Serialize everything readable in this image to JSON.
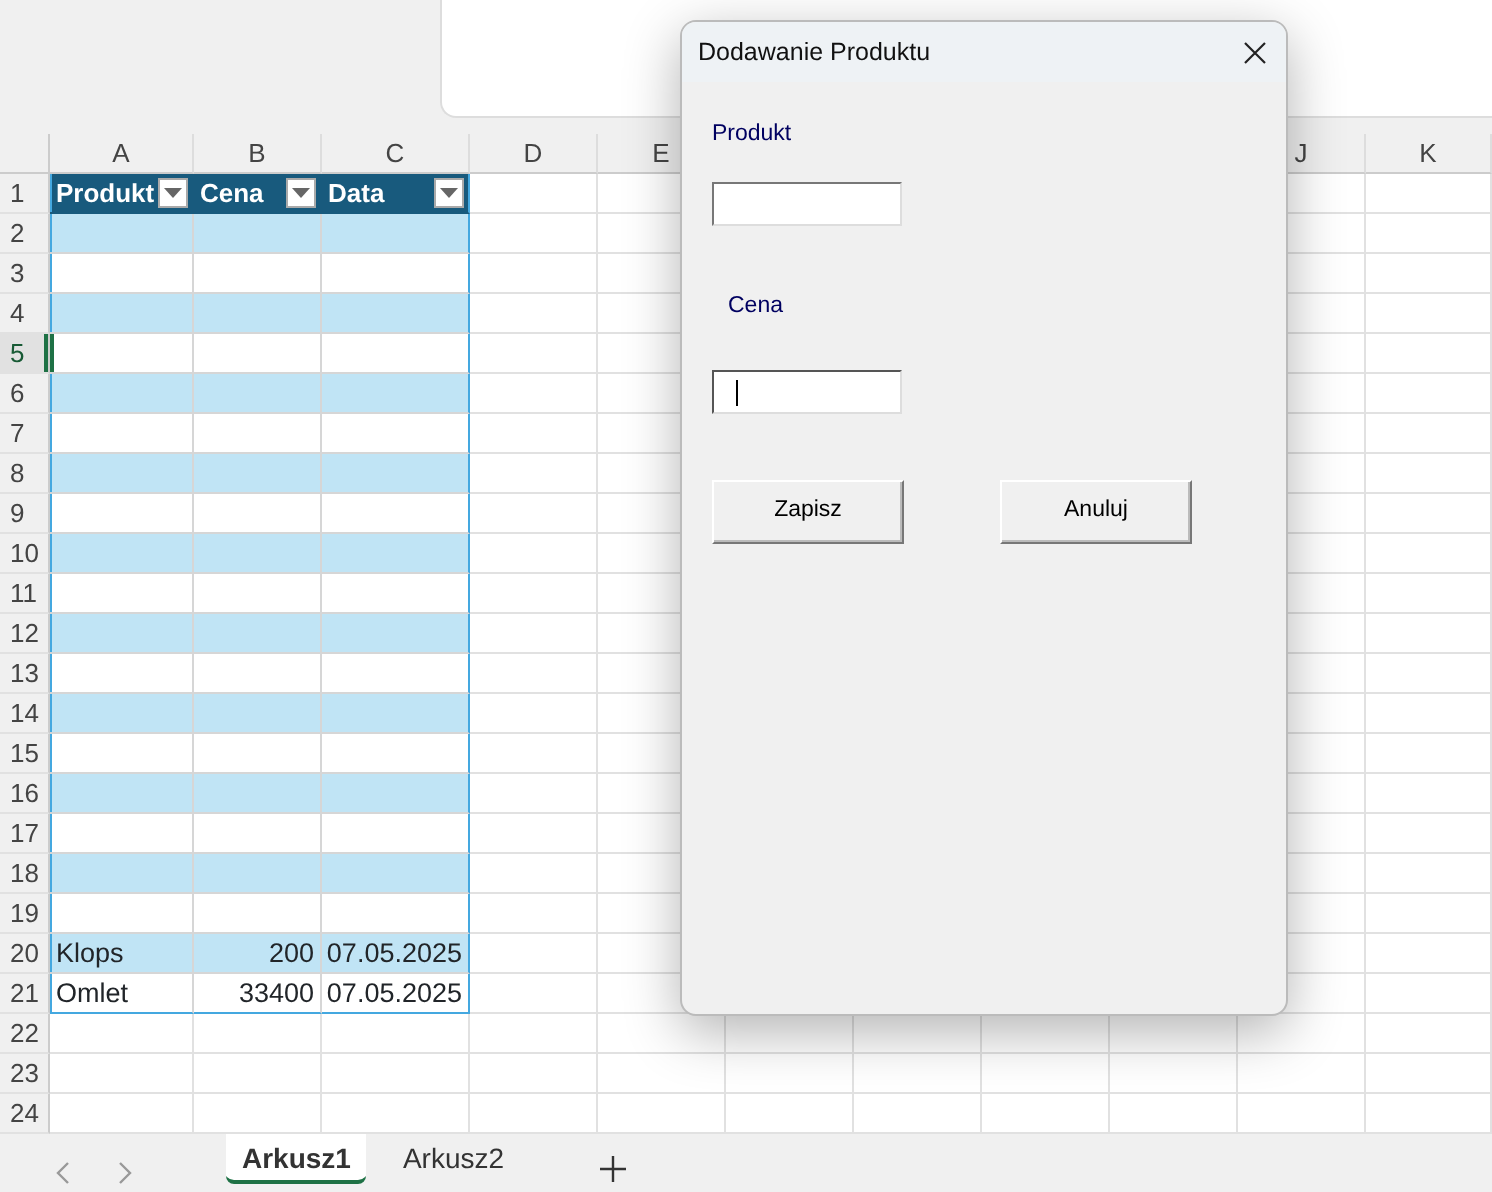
{
  "column_headers_left": [
    "A",
    "B",
    "C",
    "D",
    "E"
  ],
  "column_headers_right": [
    "J",
    "K"
  ],
  "row_headers": [
    {
      "number": "1",
      "selected": false
    },
    {
      "number": "2",
      "selected": false
    },
    {
      "number": "3",
      "selected": false
    },
    {
      "number": "4",
      "selected": false
    },
    {
      "number": "5",
      "selected": true
    },
    {
      "number": "6",
      "selected": false
    },
    {
      "number": "7",
      "selected": false
    },
    {
      "number": "8",
      "selected": false
    },
    {
      "number": "9",
      "selected": false
    },
    {
      "number": "10",
      "selected": false
    },
    {
      "number": "11",
      "selected": false
    },
    {
      "number": "12",
      "selected": false
    },
    {
      "number": "13",
      "selected": false
    },
    {
      "number": "14",
      "selected": false
    },
    {
      "number": "15",
      "selected": false
    },
    {
      "number": "16",
      "selected": false
    },
    {
      "number": "17",
      "selected": false
    },
    {
      "number": "18",
      "selected": false
    },
    {
      "number": "19",
      "selected": false
    },
    {
      "number": "20",
      "selected": false
    },
    {
      "number": "21",
      "selected": false
    },
    {
      "number": "22",
      "selected": false
    },
    {
      "number": "23",
      "selected": false
    },
    {
      "number": "24",
      "selected": false
    }
  ],
  "table": {
    "columns": [
      "Produkt",
      "Cena",
      "Data"
    ],
    "rows": [
      {
        "kind": "empty"
      },
      {
        "kind": "empty"
      },
      {
        "kind": "empty"
      },
      {
        "kind": "empty"
      },
      {
        "kind": "empty"
      },
      {
        "kind": "empty"
      },
      {
        "kind": "empty"
      },
      {
        "kind": "empty"
      },
      {
        "kind": "empty"
      },
      {
        "kind": "empty"
      },
      {
        "kind": "empty"
      },
      {
        "kind": "empty"
      },
      {
        "kind": "empty"
      },
      {
        "kind": "empty"
      },
      {
        "kind": "empty"
      },
      {
        "kind": "empty"
      },
      {
        "kind": "empty"
      },
      {
        "kind": "empty"
      },
      {
        "kind": "data",
        "cells": [
          "Klops",
          "200",
          "07.05.2025"
        ]
      },
      {
        "kind": "data",
        "cells": [
          "Omlet",
          "33400",
          "07.05.2025"
        ]
      }
    ]
  },
  "sheet_tabs": [
    {
      "label": "Arkusz1",
      "selected": true
    },
    {
      "label": "Arkusz2",
      "selected": false
    }
  ],
  "dialog": {
    "title": "Dodawanie Produktu",
    "fields": [
      {
        "label": "Produkt",
        "focused": false
      },
      {
        "label": "Cena",
        "focused": true
      }
    ],
    "buttons": [
      "Zapisz",
      "Anuluj"
    ]
  }
}
